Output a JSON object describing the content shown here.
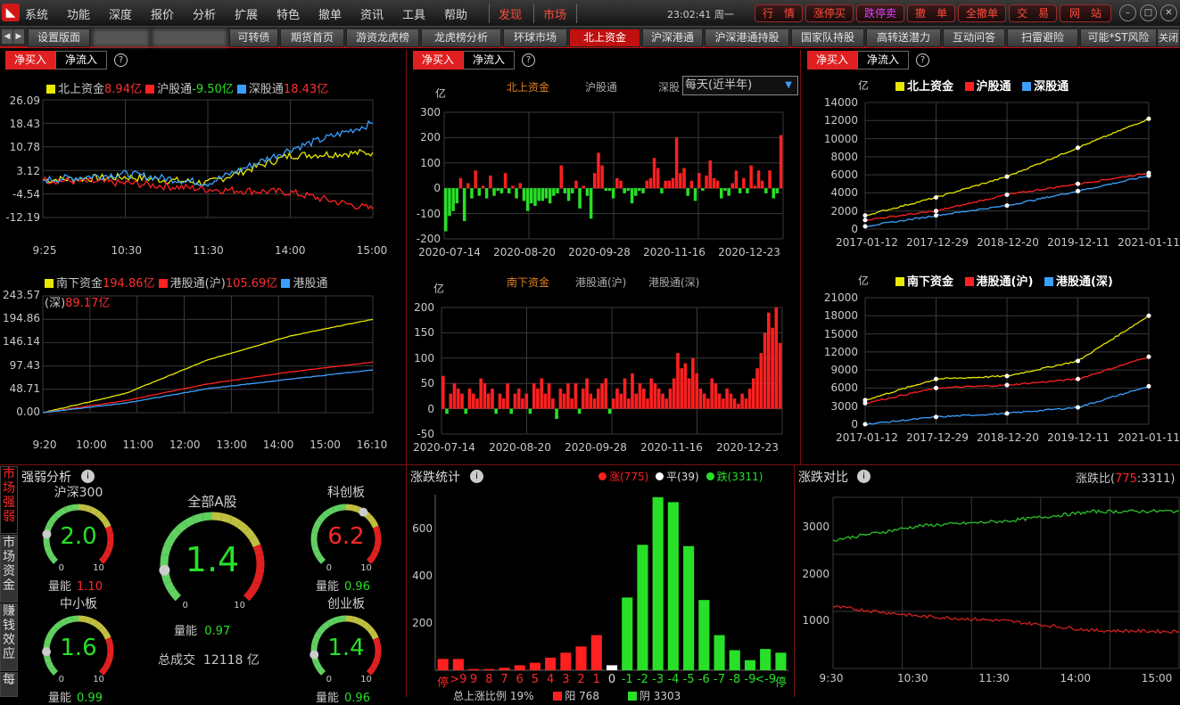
{
  "menubar": {
    "items": [
      "系统",
      "功能",
      "深度",
      "报价",
      "分析",
      "扩展",
      "特色",
      "撤单",
      "资讯",
      "工具",
      "帮助"
    ],
    "discover": "发现",
    "market": "市场",
    "clock": "23:02:41 周一",
    "right_buttons": [
      "行　情",
      "涨停买",
      "跌停卖",
      "撤　单",
      "全撤单",
      "交　易",
      "网　站"
    ]
  },
  "tabs": [
    "设置版面",
    "可转债",
    "期货首页",
    "游资龙虎榜",
    "龙虎榜分析",
    "环球市场",
    "北上资金",
    "沪深港通",
    "沪深港通持股",
    "国家队持股",
    "高转送潜力",
    "互动问答",
    "扫雷避险",
    "可能*ST风险",
    "关闭"
  ],
  "panels": {
    "buy_label": "净买入",
    "flow_label": "净流入",
    "left": {
      "top_legend": [
        {
          "name": "北上资金",
          "value": "8.94亿",
          "color": "#e8e800",
          "vcolor": "#ff3030"
        },
        {
          "name": "沪股通",
          "value": "-9.50亿",
          "color": "#ff2020",
          "vcolor": "#28e028"
        },
        {
          "name": "深股通",
          "value": "18.43亿",
          "color": "#3aa0ff",
          "vcolor": "#ff3030"
        }
      ],
      "top_y": [
        "26.09",
        "18.43",
        "10.78",
        "3.12",
        "-4.54",
        "-12.19"
      ],
      "top_x": [
        "9:25",
        "10:30",
        "11:30",
        "14:00",
        "15:00"
      ],
      "bottom_legend": [
        {
          "name": "南下资金",
          "value": "194.86亿",
          "color": "#e8e800",
          "vcolor": "#ff3030"
        },
        {
          "name": "港股通(沪)",
          "value": "105.69亿",
          "color": "#ff2020",
          "vcolor": "#ff3030"
        },
        {
          "name": "港股通",
          "value": "",
          "color": "#3aa0ff",
          "vcolor": "#ff3030"
        }
      ],
      "bottom_legend_wrap": "(深)",
      "bottom_legend_wrap_value": "89.17亿",
      "bottom_y": [
        "243.57",
        "194.86",
        "146.14",
        "97.43",
        "48.71",
        "0.00"
      ],
      "bottom_x": [
        "9:20",
        "10:00",
        "11:00",
        "12:00",
        "13:00",
        "14:00",
        "15:00",
        "16:10"
      ]
    },
    "middle": {
      "unit": "亿",
      "top_tabs": [
        "北上资金",
        "沪股通",
        "深股"
      ],
      "period": "每天(近半年)",
      "top_y": [
        "300",
        "200",
        "100",
        "0",
        "-100",
        "-200"
      ],
      "top_x": [
        "2020-07-14",
        "2020-08-20",
        "2020-09-28",
        "2020-11-16",
        "2020-12-23"
      ],
      "bottom_tabs": [
        "南下资金",
        "港股通(沪)",
        "港股通(深)"
      ],
      "bottom_y": [
        "200",
        "150",
        "100",
        "50",
        "0",
        "-50"
      ],
      "bottom_x": [
        "2020-07-14",
        "2020-08-20",
        "2020-09-28",
        "2020-11-16",
        "2020-12-23"
      ]
    },
    "right": {
      "unit": "亿",
      "top_legend": [
        "北上资金",
        "沪股通",
        "深股通"
      ],
      "top_y": [
        "14000",
        "12000",
        "10000",
        "8000",
        "6000",
        "4000",
        "2000",
        "0"
      ],
      "top_x": [
        "2017-01-12",
        "2017-12-29",
        "2018-12-20",
        "2019-12-11",
        "2021-01-11"
      ],
      "bottom_legend": [
        "南下资金",
        "港股通(沪)",
        "港股通(深)"
      ],
      "bottom_y": [
        "21000",
        "18000",
        "15000",
        "12000",
        "9000",
        "6000",
        "3000",
        "0"
      ],
      "bottom_x": [
        "2017-01-12",
        "2017-12-29",
        "2018-12-20",
        "2019-12-11",
        "2021-01-11"
      ]
    }
  },
  "strength": {
    "sidebar": [
      "市场强弱",
      "市场资金",
      "赚钱效应",
      "每"
    ],
    "title": "强弱分析",
    "gauges": [
      {
        "title": "沪深300",
        "value": "2.0",
        "vol": "1.10",
        "vol_red": true,
        "value_red": false
      },
      {
        "title": "全部A股",
        "value": "1.4",
        "vol": "0.97",
        "vol_red": false,
        "value_red": false
      },
      {
        "title": "科创板",
        "value": "6.2",
        "vol": "0.96",
        "vol_red": false,
        "value_red": true
      },
      {
        "title": "中小板",
        "value": "1.6",
        "vol": "0.99",
        "vol_red": false,
        "value_red": false
      },
      {
        "title": "创业板",
        "value": "1.4",
        "vol": "0.96",
        "vol_red": false,
        "value_red": false
      }
    ],
    "vol_label": "量能",
    "gauge_min": "0",
    "gauge_max": "10",
    "turnover_label": "总成交",
    "turnover": "12118 亿"
  },
  "updown": {
    "title": "涨跌统计",
    "legend": [
      {
        "label": "涨(775)",
        "color": "#ff2020"
      },
      {
        "label": "平(39)",
        "color": "#ffffff"
      },
      {
        "label": "跌(3311)",
        "color": "#28e028"
      }
    ],
    "y": [
      "600",
      "400",
      "200"
    ],
    "x": [
      "停",
      ">9",
      "9",
      "8",
      "7",
      "6",
      "5",
      "4",
      "3",
      "2",
      "1",
      "0",
      "-1",
      "-2",
      "-3",
      "-4",
      "-5",
      "-6",
      "-7",
      "-8",
      "-9",
      "<-9",
      "停"
    ],
    "footer": [
      "总上涨比例 19%",
      "阳 768",
      "阴 3303"
    ]
  },
  "compare": {
    "title": "涨跌对比",
    "ratio_label": "涨跌比(",
    "ratio_up": "775",
    "ratio_down": ":3311)",
    "y": [
      "3000",
      "2000",
      "1000"
    ],
    "x": [
      "9:30",
      "10:30",
      "11:30",
      "14:00",
      "15:00"
    ]
  },
  "chart_data": [
    {
      "type": "line",
      "title": "北上资金",
      "x": [
        "9:25",
        "10:30",
        "11:30",
        "14:00",
        "15:00"
      ],
      "series": [
        {
          "name": "北上资金",
          "values": [
            0,
            1,
            -1,
            8,
            8.94
          ]
        },
        {
          "name": "沪股通",
          "values": [
            0,
            -1,
            -3,
            -4,
            -9.5
          ]
        },
        {
          "name": "深股通",
          "values": [
            0,
            2,
            -1,
            10,
            18.43
          ]
        }
      ],
      "ylim": [
        -12.19,
        26.09
      ]
    },
    {
      "type": "line",
      "title": "南下资金",
      "x": [
        "9:20",
        "10:00",
        "12:00",
        "14:00",
        "16:10"
      ],
      "series": [
        {
          "name": "南下资金",
          "values": [
            0,
            40,
            110,
            160,
            194.86
          ]
        },
        {
          "name": "港股通(沪)",
          "values": [
            0,
            25,
            60,
            85,
            105.69
          ]
        },
        {
          "name": "港股通(深)",
          "values": [
            0,
            20,
            50,
            70,
            89.17
          ]
        }
      ],
      "ylim": [
        0,
        243.57
      ]
    },
    {
      "type": "bar",
      "title": "北上资金",
      "ylim": [
        -200,
        300
      ],
      "values": [
        -170,
        -110,
        -90,
        -60,
        40,
        -130,
        20,
        -40,
        70,
        -30,
        10,
        -40,
        50,
        -30,
        -10,
        -20,
        60,
        -20,
        10,
        -40,
        20,
        -50,
        -90,
        -60,
        -70,
        -50,
        -50,
        -40,
        -60,
        -30,
        -20,
        90,
        -20,
        -50,
        -20,
        30,
        -80,
        10,
        -30,
        -120,
        60,
        140,
        90,
        -10,
        -10,
        -40,
        40,
        30,
        -20,
        -10,
        -60,
        -30,
        -10,
        -20,
        30,
        40,
        120,
        80,
        -20,
        30,
        30,
        40,
        200,
        60,
        80,
        -30,
        30,
        -50,
        60,
        -10,
        50,
        110,
        40,
        30,
        -40,
        -10,
        -30,
        20,
        70,
        -20,
        40,
        -20,
        90,
        10,
        70,
        30,
        -20,
        70,
        -40,
        -20,
        210
      ]
    },
    {
      "type": "bar",
      "title": "南下资金",
      "ylim": [
        -50,
        200
      ],
      "values": [
        65,
        -10,
        30,
        50,
        40,
        30,
        -10,
        40,
        30,
        20,
        60,
        50,
        30,
        40,
        -10,
        30,
        20,
        50,
        -10,
        30,
        40,
        20,
        30,
        -10,
        50,
        40,
        60,
        30,
        50,
        20,
        -20,
        40,
        30,
        50,
        20,
        50,
        -10,
        40,
        60,
        30,
        20,
        40,
        50,
        60,
        -10,
        20,
        40,
        30,
        60,
        20,
        70,
        30,
        50,
        40,
        20,
        60,
        50,
        40,
        30,
        20,
        40,
        60,
        110,
        80,
        90,
        60,
        100,
        70,
        40,
        30,
        20,
        60,
        50,
        30,
        20,
        40,
        30,
        20,
        10,
        30,
        20,
        40,
        60,
        80,
        110,
        150,
        190,
        160,
        200,
        130
      ]
    },
    {
      "type": "line",
      "title": "北上资金累计",
      "x": [
        "2017-01-12",
        "2017-12-29",
        "2018-12-20",
        "2019-12-11",
        "2021-01-11"
      ],
      "series": [
        {
          "name": "北上资金",
          "values": [
            1500,
            3500,
            5800,
            9000,
            12200
          ]
        },
        {
          "name": "沪股通",
          "values": [
            1000,
            2000,
            3800,
            5000,
            6200
          ]
        },
        {
          "name": "深股通",
          "values": [
            300,
            1500,
            2600,
            4200,
            5900
          ]
        }
      ],
      "ylim": [
        0,
        14000
      ]
    },
    {
      "type": "line",
      "title": "南下资金累计",
      "x": [
        "2017-01-12",
        "2017-12-29",
        "2018-12-20",
        "2019-12-11",
        "2021-01-11"
      ],
      "series": [
        {
          "name": "南下资金",
          "values": [
            4000,
            7500,
            8000,
            10500,
            18000
          ]
        },
        {
          "name": "港股通(沪)",
          "values": [
            3500,
            6000,
            6500,
            7500,
            11200
          ]
        },
        {
          "name": "港股通(深)",
          "values": [
            0,
            1200,
            1800,
            2800,
            6300
          ]
        }
      ],
      "ylim": [
        0,
        21000
      ]
    },
    {
      "type": "bar",
      "title": "涨跌统计",
      "categories": [
        "停",
        ">9",
        "9",
        "8",
        "7",
        "6",
        "5",
        "4",
        "3",
        "2",
        "1",
        "0",
        "-1",
        "-2",
        "-3",
        "-4",
        "-5",
        "-6",
        "-7",
        "-8",
        "-9",
        "<-9",
        "停"
      ],
      "values": [
        45,
        45,
        5,
        5,
        10,
        20,
        30,
        50,
        70,
        95,
        140,
        20,
        290,
        500,
        690,
        670,
        495,
        280,
        140,
        80,
        40,
        85,
        70
      ],
      "colors": [
        "#ff2020",
        "#ff2020",
        "#ff2020",
        "#ff2020",
        "#ff2020",
        "#ff2020",
        "#ff2020",
        "#ff2020",
        "#ff2020",
        "#ff2020",
        "#ff2020",
        "#ffffff",
        "#28e028",
        "#28e028",
        "#28e028",
        "#28e028",
        "#28e028",
        "#28e028",
        "#28e028",
        "#28e028",
        "#28e028",
        "#28e028",
        "#28e028"
      ],
      "ylim": [
        0,
        700
      ]
    },
    {
      "type": "line",
      "title": "涨跌对比",
      "x": [
        "9:30",
        "10:30",
        "11:30",
        "14:00",
        "15:00"
      ],
      "series": [
        {
          "name": "涨",
          "values": [
            1300,
            1100,
            1000,
            800,
            775
          ]
        },
        {
          "name": "跌",
          "values": [
            2700,
            3000,
            3100,
            3300,
            3311
          ]
        }
      ],
      "ylim": [
        0,
        3600
      ]
    }
  ]
}
